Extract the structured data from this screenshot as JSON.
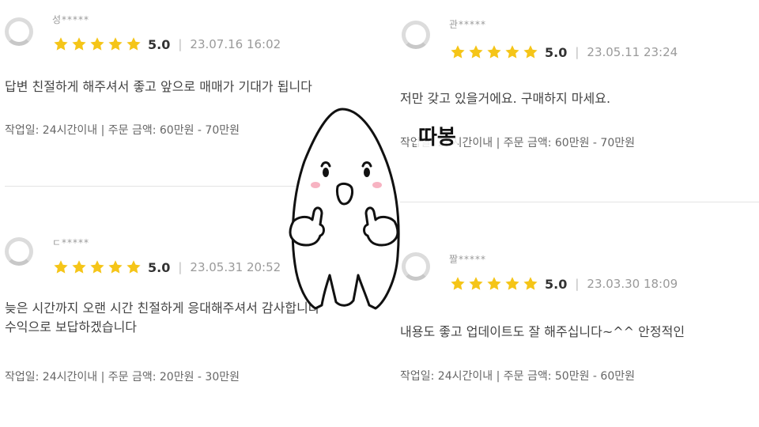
{
  "reviews": [
    {
      "user": "성*****",
      "score": "5.0",
      "date": "23.07.16 16:02",
      "content": "답변 친절하게 해주셔서 좋고 앞으로 매매가 기대가 됩니다",
      "content2": "",
      "meta": "작업일: 24시간이내 | 주문 금액: 60만원 - 70만원"
    },
    {
      "user": "관*****",
      "score": "5.0",
      "date": "23.05.11 23:24",
      "content": "저만 갖고 있을거에요. 구매하지 마세요.",
      "content2": "",
      "meta": "작업일: 24시간이내 | 주문 금액: 60만원 - 70만원"
    },
    {
      "user": "ㄷ*****",
      "score": "5.0",
      "date": "23.05.31 20:52",
      "content": "늦은 시간까지 오랜 시간 친절하게 응대해주셔서 감사합니다",
      "content2": "수익으로 보답하겠습니다",
      "meta": "작업일: 24시간이내 | 주문 금액: 20만원 - 30만원"
    },
    {
      "user": "짤*****",
      "score": "5.0",
      "date": "23.03.30 18:09",
      "content": "내용도 좋고 업데이트도 잘 해주십니다~^^ 안정적인",
      "content2": "",
      "meta": "작업일: 24시간이내 | 주문 금액: 50만원 - 60만원"
    }
  ],
  "rating_separator": "|",
  "star_color": "#F5C518",
  "mascot": {
    "label": "따봉",
    "icon": "rice-grain-thumbs-up-character"
  }
}
